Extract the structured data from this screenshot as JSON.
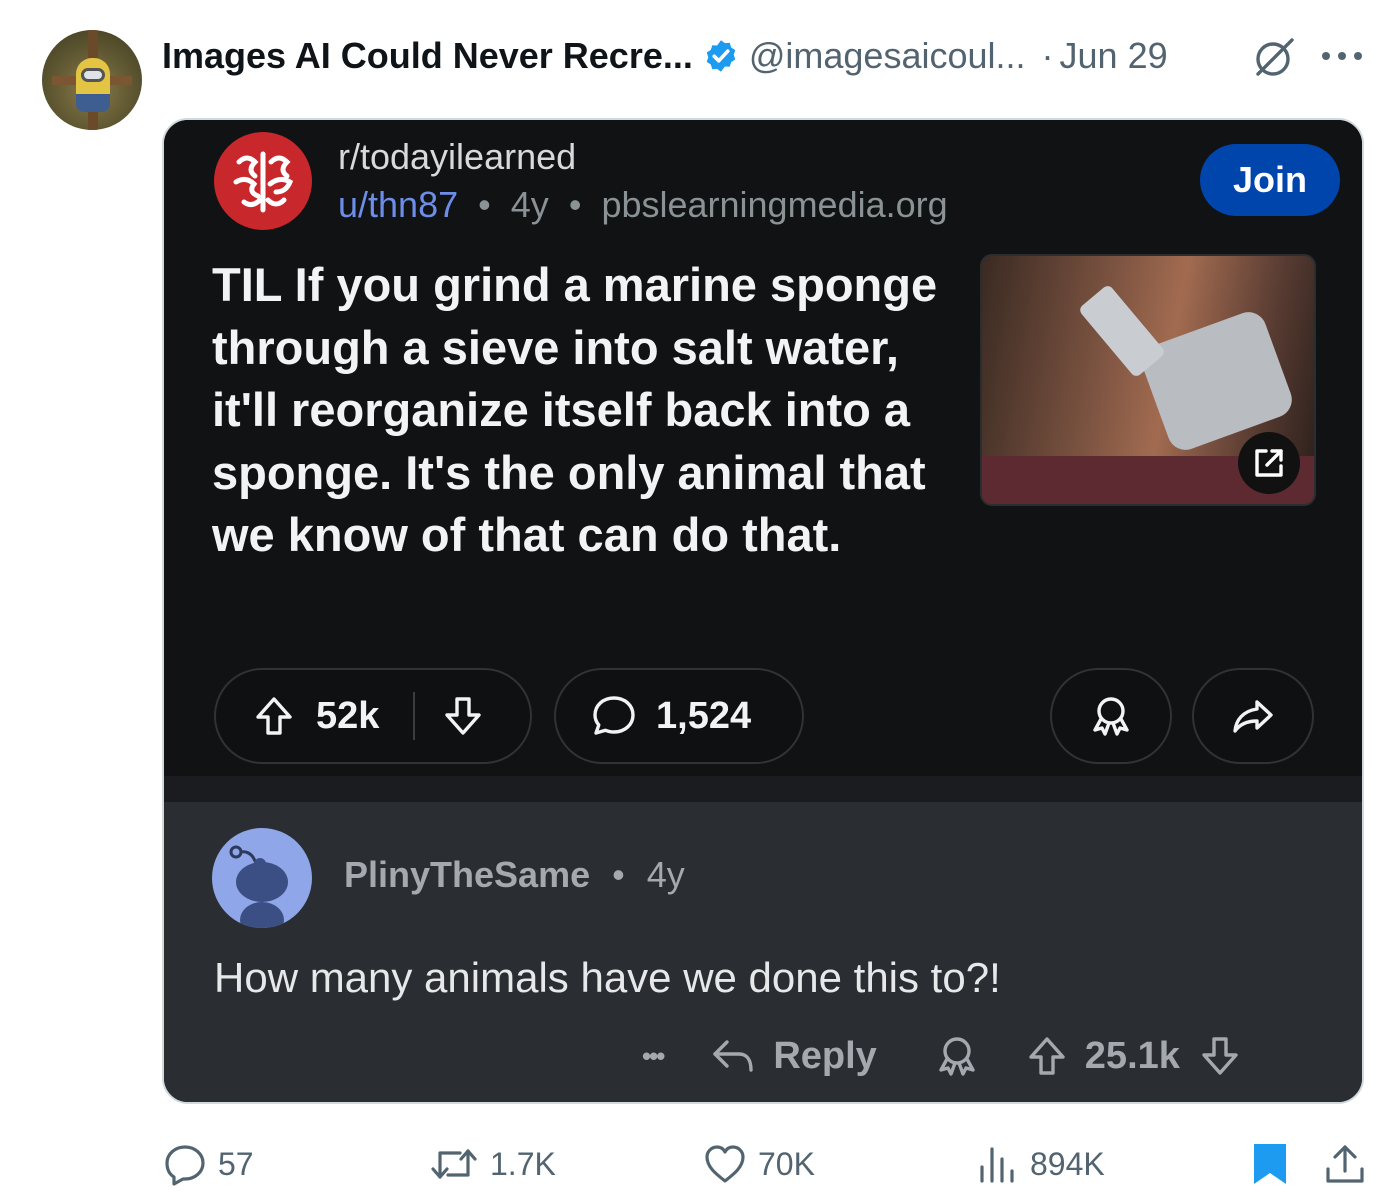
{
  "tweet": {
    "author_name": "Images AI Could Never Recre...",
    "handle": "@imagesaicoul...",
    "separator": "·",
    "date": "Jun 29",
    "colors": {
      "verified": "#1d9bf0",
      "secondary_text": "#536471"
    }
  },
  "reddit_post": {
    "subreddit": "r/todayilearned",
    "username": "u/thn87",
    "sep1": "•",
    "age": "4y",
    "sep2": "•",
    "domain": "pbslearningmedia.org",
    "join_label": "Join",
    "title": "TIL If you grind a marine sponge through a sieve into salt water, it'll reorganize itself back into a sponge. It's the only animal that we know of that can do that.",
    "upvotes": "52k",
    "comments": "1,524",
    "colors": {
      "card_bg": "#101214",
      "subreddit_logo": "#c8272c",
      "join_button": "#0045ac",
      "username": "#6d8ee8"
    }
  },
  "reddit_comment": {
    "username": "PlinyTheSame",
    "sep": "•",
    "age": "4y",
    "text": "How many animals have we done this to?!",
    "more_label": "•••",
    "reply_label": "Reply",
    "score": "25.1k",
    "colors": {
      "comment_bg": "#2a2d31",
      "avatar_bg": "#8fa6e8"
    }
  },
  "tweet_stats": {
    "replies": "57",
    "retweets": "1.7K",
    "likes": "70K",
    "views": "894K",
    "colors": {
      "bookmark": "#1d9bf0"
    }
  },
  "icons": [
    "verified-icon",
    "grok-icon",
    "more-icon",
    "subreddit-brain-icon",
    "external-link-icon",
    "upvote-icon",
    "downvote-icon",
    "comment-icon",
    "award-icon",
    "share-icon",
    "reply-arrow-icon",
    "reply-icon",
    "retweet-icon",
    "like-icon",
    "views-icon",
    "bookmark-icon",
    "upload-icon"
  ]
}
